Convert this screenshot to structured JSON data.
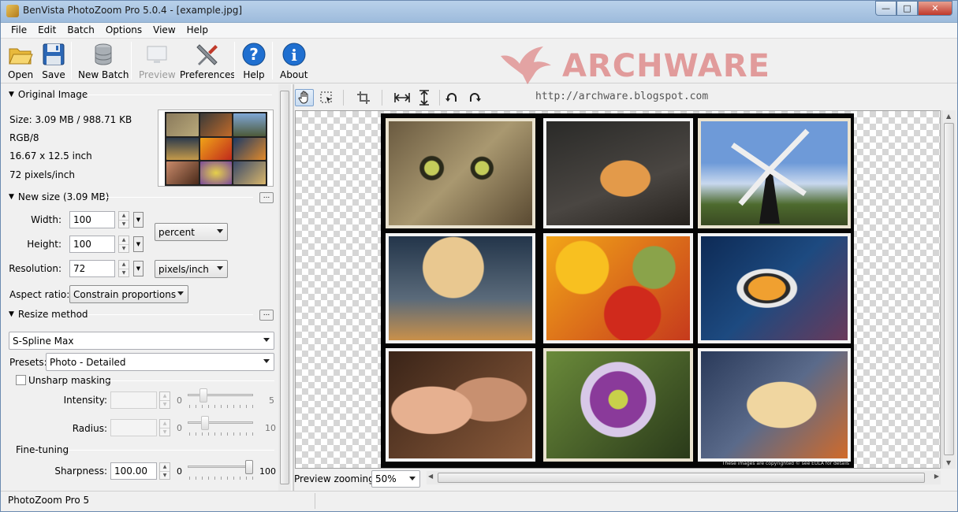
{
  "window": {
    "title": "BenVista PhotoZoom Pro 5.0.4 - [example.jpg]"
  },
  "menu": [
    "File",
    "Edit",
    "Batch",
    "Options",
    "View",
    "Help"
  ],
  "toolbar": {
    "open": "Open",
    "save": "Save",
    "new_batch": "New Batch",
    "preview": "Preview",
    "preferences": "Preferences",
    "help": "Help",
    "about": "About"
  },
  "watermark": {
    "brand": "ARCHWARE",
    "url": "http://archware.blogspot.com"
  },
  "original": {
    "header": "Original Image",
    "size": "Size: 3.09 MB / 988.71 KB",
    "mode": "RGB/8",
    "dimensions": "16.67 x 12.5 inch",
    "resolution": "72 pixels/inch"
  },
  "newsize": {
    "header": "New size (3.09 MB)",
    "width_label": "Width:",
    "width_value": "100",
    "height_label": "Height:",
    "height_value": "100",
    "resolution_label": "Resolution:",
    "resolution_value": "72",
    "unit": "percent",
    "res_unit": "pixels/inch",
    "aspect_label": "Aspect ratio:",
    "aspect_value": "Constrain proportions"
  },
  "resize": {
    "header": "Resize method",
    "method": "S-Spline Max",
    "presets_label": "Presets:",
    "preset_value": "Photo - Detailed",
    "unsharp_label": "Unsharp masking",
    "unsharp_checked": false,
    "intensity_label": "Intensity:",
    "intensity_min": "0",
    "intensity_max": "5",
    "radius_label": "Radius:",
    "radius_min": "0",
    "radius_max": "10",
    "finetuning_label": "Fine-tuning",
    "sharpness_label": "Sharpness:",
    "sharpness_value": "100.00",
    "sharpness_min": "0",
    "sharpness_max": "100",
    "sharpness_level": 1.0
  },
  "preview": {
    "zoom_label": "Preview zooming:",
    "zoom_value": "50%",
    "copyright": "These images are copyrighted © see EULA for details",
    "photos": [
      "cat",
      "seashell",
      "windmill",
      "observatory",
      "fruits",
      "fish",
      "couple",
      "flower",
      "food"
    ]
  },
  "status": {
    "text": "PhotoZoom Pro 5"
  },
  "colors": {
    "accent": "#1f6fd0",
    "titlebar": "#b9d1ea",
    "watermark": "#d65656"
  }
}
